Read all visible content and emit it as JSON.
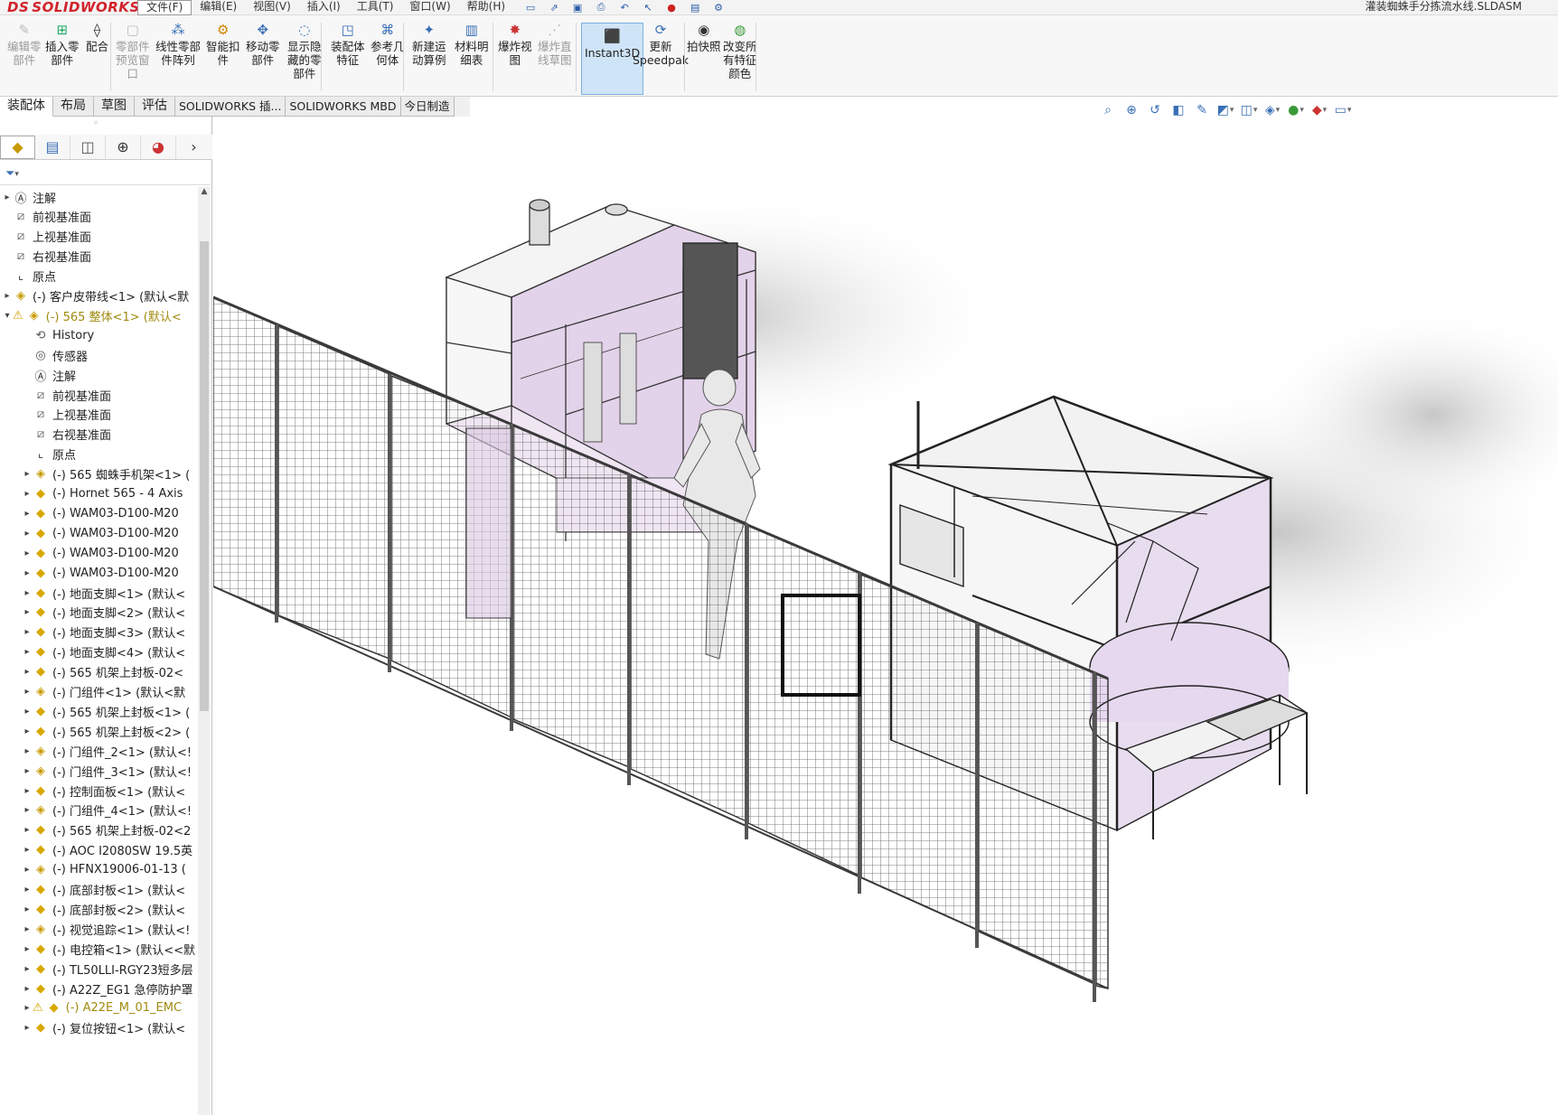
{
  "app": {
    "logo_ds": "DS",
    "logo_text": "SOLIDWORKS",
    "document_title": "灌装蜘蛛手分拣流水线.SLDASM"
  },
  "menu": [
    "文件(F)",
    "编辑(E)",
    "视图(V)",
    "插入(I)",
    "工具(T)",
    "窗口(W)",
    "帮助(H)"
  ],
  "ribbon": {
    "buttons": [
      {
        "label": "编辑零\n部件",
        "icon": "edit-component-icon",
        "disabled": true
      },
      {
        "label": "插入零\n部件",
        "icon": "insert-component-icon",
        "disabled": false
      },
      {
        "label": "配合",
        "icon": "mate-icon",
        "disabled": false
      },
      {
        "label": "零部件\n预览窗\n口",
        "icon": "component-preview-icon",
        "disabled": true
      },
      {
        "label": "线性零部\n件阵列",
        "icon": "linear-pattern-icon",
        "disabled": false
      },
      {
        "label": "智能扣\n件",
        "icon": "smart-fasteners-icon",
        "disabled": false
      },
      {
        "label": "移动零\n部件",
        "icon": "move-component-icon",
        "disabled": false
      },
      {
        "label": "显示隐\n藏的零\n部件",
        "icon": "show-hidden-icon",
        "disabled": false
      },
      {
        "label": "装配体\n特征",
        "icon": "assembly-features-icon",
        "disabled": false
      },
      {
        "label": "参考几\n何体",
        "icon": "reference-geometry-icon",
        "disabled": false
      },
      {
        "label": "新建运\n动算例",
        "icon": "new-motion-study-icon",
        "disabled": false
      },
      {
        "label": "材料明\n细表",
        "icon": "bom-icon",
        "disabled": false
      },
      {
        "label": "爆炸视\n图",
        "icon": "exploded-view-icon",
        "disabled": false
      },
      {
        "label": "爆炸直\n线草图",
        "icon": "explode-line-sketch-icon",
        "disabled": true
      },
      {
        "label": "Instant3D",
        "icon": "instant3d-icon",
        "disabled": false,
        "active": true
      },
      {
        "label": "更新\nSpeedpak",
        "icon": "speedpak-icon",
        "disabled": false
      },
      {
        "label": "拍快照",
        "icon": "snapshot-icon",
        "disabled": false
      },
      {
        "label": "改变所\n有特征\n颜色",
        "icon": "change-color-icon",
        "disabled": false
      }
    ]
  },
  "command_tabs": [
    "装配体",
    "布局",
    "草图",
    "评估",
    "SOLIDWORKS 插...",
    "SOLIDWORKS MBD",
    "今日制造"
  ],
  "tree": [
    {
      "label": "注解",
      "icon": "annotation-icon",
      "level": 0,
      "expand": "▸"
    },
    {
      "label": "前视基准面",
      "icon": "plane-icon",
      "level": 0,
      "expand": ""
    },
    {
      "label": "上视基准面",
      "icon": "plane-icon",
      "level": 0,
      "expand": ""
    },
    {
      "label": "右视基准面",
      "icon": "plane-icon",
      "level": 0,
      "expand": ""
    },
    {
      "label": "原点",
      "icon": "origin-icon",
      "level": 0,
      "expand": ""
    },
    {
      "label": "(-) 客户皮带线<1> (默认<默",
      "icon": "assembly-icon",
      "level": 0,
      "expand": "▸"
    },
    {
      "label": "(-) 565 整体<1> (默认<",
      "icon": "assembly-icon",
      "level": 0,
      "expand": "▾",
      "warn": true
    },
    {
      "label": "History",
      "icon": "history-icon",
      "level": 1,
      "expand": ""
    },
    {
      "label": "传感器",
      "icon": "sensor-icon",
      "level": 1,
      "expand": ""
    },
    {
      "label": "注解",
      "icon": "annotation-icon",
      "level": 1,
      "expand": ""
    },
    {
      "label": "前视基准面",
      "icon": "plane-icon",
      "level": 1,
      "expand": ""
    },
    {
      "label": "上视基准面",
      "icon": "plane-icon",
      "level": 1,
      "expand": ""
    },
    {
      "label": "右视基准面",
      "icon": "plane-icon",
      "level": 1,
      "expand": ""
    },
    {
      "label": "原点",
      "icon": "origin-icon",
      "level": 1,
      "expand": ""
    },
    {
      "label": "(-) 565 蜘蛛手机架<1> (",
      "icon": "assembly-icon",
      "level": 1,
      "expand": "▸"
    },
    {
      "label": "(-) Hornet 565 - 4 Axis",
      "icon": "part-icon",
      "level": 1,
      "expand": "▸"
    },
    {
      "label": "(-) WAM03-D100-M20",
      "icon": "part-icon",
      "level": 1,
      "expand": "▸"
    },
    {
      "label": "(-) WAM03-D100-M20",
      "icon": "part-icon",
      "level": 1,
      "expand": "▸"
    },
    {
      "label": "(-) WAM03-D100-M20",
      "icon": "part-icon",
      "level": 1,
      "expand": "▸"
    },
    {
      "label": "(-) WAM03-D100-M20",
      "icon": "part-icon",
      "level": 1,
      "expand": "▸"
    },
    {
      "label": "(-) 地面支脚<1> (默认<",
      "icon": "part-icon",
      "level": 1,
      "expand": "▸"
    },
    {
      "label": "(-) 地面支脚<2> (默认<",
      "icon": "part-icon",
      "level": 1,
      "expand": "▸"
    },
    {
      "label": "(-) 地面支脚<3> (默认<",
      "icon": "part-icon",
      "level": 1,
      "expand": "▸"
    },
    {
      "label": "(-) 地面支脚<4> (默认<",
      "icon": "part-icon",
      "level": 1,
      "expand": "▸"
    },
    {
      "label": "(-) 565 机架上封板-02<",
      "icon": "part-icon",
      "level": 1,
      "expand": "▸"
    },
    {
      "label": "(-) 门组件<1> (默认<默",
      "icon": "assembly-icon",
      "level": 1,
      "expand": "▸"
    },
    {
      "label": "(-) 565 机架上封板<1> (",
      "icon": "part-icon",
      "level": 1,
      "expand": "▸"
    },
    {
      "label": "(-) 565 机架上封板<2> (",
      "icon": "part-icon",
      "level": 1,
      "expand": "▸"
    },
    {
      "label": "(-) 门组件_2<1> (默认<!",
      "icon": "assembly-icon",
      "level": 1,
      "expand": "▸"
    },
    {
      "label": "(-) 门组件_3<1> (默认<!",
      "icon": "assembly-icon",
      "level": 1,
      "expand": "▸"
    },
    {
      "label": "(-) 控制面板<1> (默认<",
      "icon": "part-icon",
      "level": 1,
      "expand": "▸"
    },
    {
      "label": "(-) 门组件_4<1> (默认<!",
      "icon": "assembly-icon",
      "level": 1,
      "expand": "▸"
    },
    {
      "label": "(-) 565 机架上封板-02<2",
      "icon": "part-icon",
      "level": 1,
      "expand": "▸"
    },
    {
      "label": "(-) AOC I2080SW 19.5英",
      "icon": "part-icon",
      "level": 1,
      "expand": "▸"
    },
    {
      "label": "(-) HFNX19006-01-13 (",
      "icon": "assembly-icon",
      "level": 1,
      "expand": "▸"
    },
    {
      "label": "(-) 底部封板<1> (默认<",
      "icon": "part-icon",
      "level": 1,
      "expand": "▸"
    },
    {
      "label": "(-) 底部封板<2> (默认<",
      "icon": "part-icon",
      "level": 1,
      "expand": "▸"
    },
    {
      "label": "(-) 视觉追踪<1> (默认<!",
      "icon": "assembly-icon",
      "level": 1,
      "expand": "▸"
    },
    {
      "label": "(-) 电控箱<1> (默认<<默",
      "icon": "part-icon",
      "level": 1,
      "expand": "▸"
    },
    {
      "label": "(-) TL50LLI-RGY23短多层",
      "icon": "part-icon",
      "level": 1,
      "expand": "▸"
    },
    {
      "label": "(-) A22Z_EG1 急停防护罩",
      "icon": "part-icon",
      "level": 1,
      "expand": "▸"
    },
    {
      "label": "(-) A22E_M_01_EMC",
      "icon": "part-icon",
      "level": 1,
      "expand": "▸",
      "warn": true
    },
    {
      "label": "(-) 复位按钮<1> (默认<",
      "icon": "part-icon",
      "level": 1,
      "expand": "▸"
    }
  ],
  "colors": {
    "accent": "#2a5da8",
    "warning": "#d3a000",
    "enclosure_fill": "#e9dcef",
    "frame": "#6a6a6a"
  }
}
